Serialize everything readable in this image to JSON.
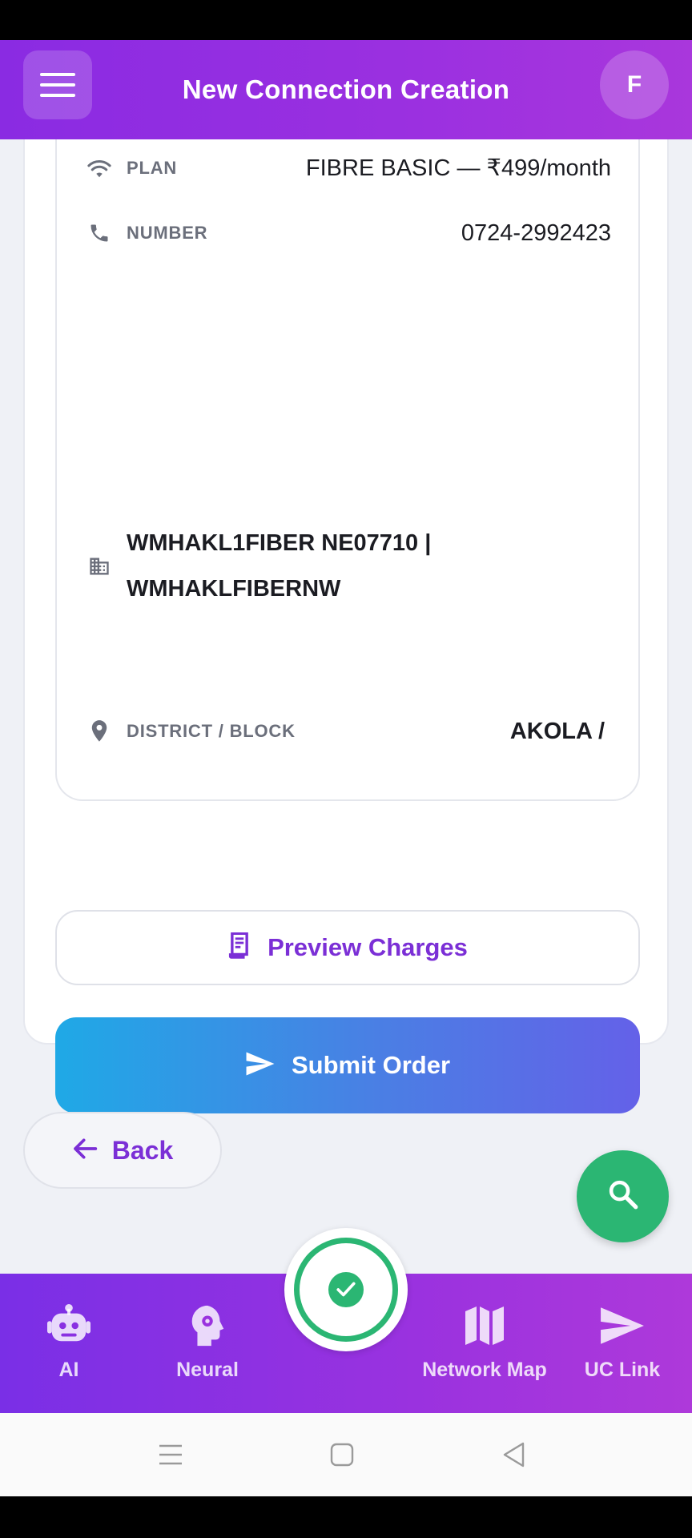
{
  "app_bar": {
    "title": "New Connection Creation",
    "avatar_initial": "F"
  },
  "details": {
    "plan": {
      "label": "PLAN",
      "value": "FIBRE BASIC — ₹499/month",
      "icon": "wifi-icon"
    },
    "number": {
      "label": "NUMBER",
      "value": "0724-2992423",
      "icon": "phone-icon"
    },
    "exchange": {
      "line1": "WMHAKL1FIBER NE07710 |",
      "line2": "WMHAKLFIBERNW",
      "icon": "building-icon"
    },
    "district": {
      "label": "DISTRICT / BLOCK",
      "value": "AKOLA /",
      "icon": "location-pin-icon"
    }
  },
  "actions": {
    "preview_label": "Preview Charges",
    "submit_label": "Submit Order",
    "back_label": "Back"
  },
  "bottom_nav": {
    "items": [
      {
        "label": "AI",
        "icon": "robot-icon"
      },
      {
        "label": "Neural",
        "icon": "brain-head-icon"
      },
      {
        "label": "Network Map",
        "icon": "map-icon"
      },
      {
        "label": "UC Link",
        "icon": "send-icon"
      }
    ]
  },
  "colors": {
    "primary_purple": "#8a2be2",
    "accent_text": "#7b2fd6",
    "success_green": "#2bb673",
    "submit_gradient_start": "#1fa9e6",
    "submit_gradient_end": "#6461e8"
  }
}
